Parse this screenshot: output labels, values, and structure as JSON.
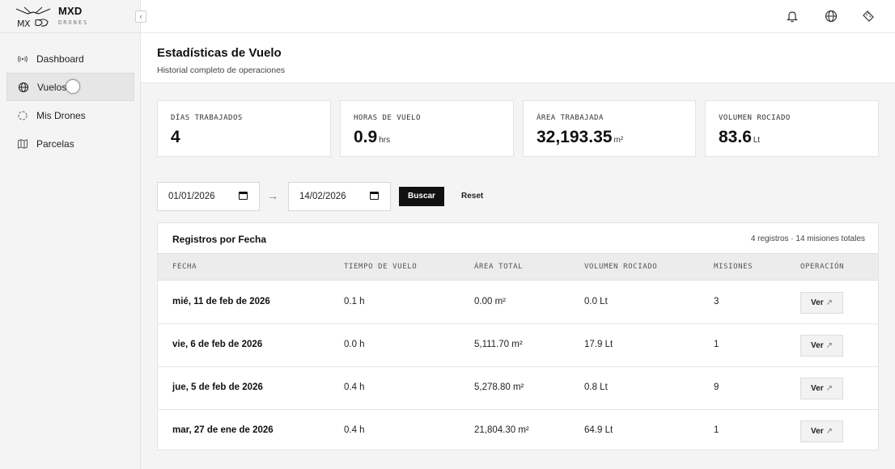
{
  "brand": {
    "name": "MXD",
    "sub": "DRONES"
  },
  "sidebar": {
    "items": [
      {
        "label": "Dashboard",
        "icon": "broadcast-icon",
        "active": false
      },
      {
        "label": "Vuelos",
        "icon": "globe-icon",
        "active": true
      },
      {
        "label": "Mis Drones",
        "icon": "drone-icon",
        "active": false
      },
      {
        "label": "Parcelas",
        "icon": "map-icon",
        "active": false
      }
    ]
  },
  "topbar": {
    "icons": [
      "bell-icon",
      "globe-icon",
      "ruler-icon"
    ]
  },
  "page": {
    "title": "Estadísticas de Vuelo",
    "subtitle": "Historial completo de operaciones"
  },
  "stats": [
    {
      "label": "DÍAS TRABAJADOS",
      "value": "4",
      "unit": ""
    },
    {
      "label": "HORAS DE VUELO",
      "value": "0.9",
      "unit": "hrs"
    },
    {
      "label": "ÁREA TRABAJADA",
      "value": "32,193.35",
      "unit": "m²"
    },
    {
      "label": "VOLUMEN ROCIADO",
      "value": "83.6",
      "unit": "Lt"
    }
  ],
  "filters": {
    "date_from": "01/01/2026",
    "date_to": "14/02/2026",
    "arrow": "→",
    "search_label": "Buscar",
    "reset_label": "Reset"
  },
  "table": {
    "title": "Registros por Fecha",
    "meta": "4 registros · 14 misiones totales",
    "columns": [
      "FECHA",
      "TIEMPO DE VUELO",
      "ÁREA TOTAL",
      "VOLUMEN ROCIADO",
      "MISIONES",
      "OPERACIÓN"
    ],
    "view_label": "Ver",
    "rows": [
      {
        "date": "mié, 11 de feb de 2026",
        "time": "0.1 h",
        "area": "0.00 m²",
        "volume": "0.0 Lt",
        "missions": "3"
      },
      {
        "date": "vie, 6 de feb de 2026",
        "time": "0.0 h",
        "area": "5,111.70 m²",
        "volume": "17.9 Lt",
        "missions": "1"
      },
      {
        "date": "jue, 5 de feb de 2026",
        "time": "0.4 h",
        "area": "5,278.80 m²",
        "volume": "0.8 Lt",
        "missions": "9"
      },
      {
        "date": "mar, 27 de ene de 2026",
        "time": "0.4 h",
        "area": "21,804.30 m²",
        "volume": "64.9 Lt",
        "missions": "1"
      }
    ]
  }
}
